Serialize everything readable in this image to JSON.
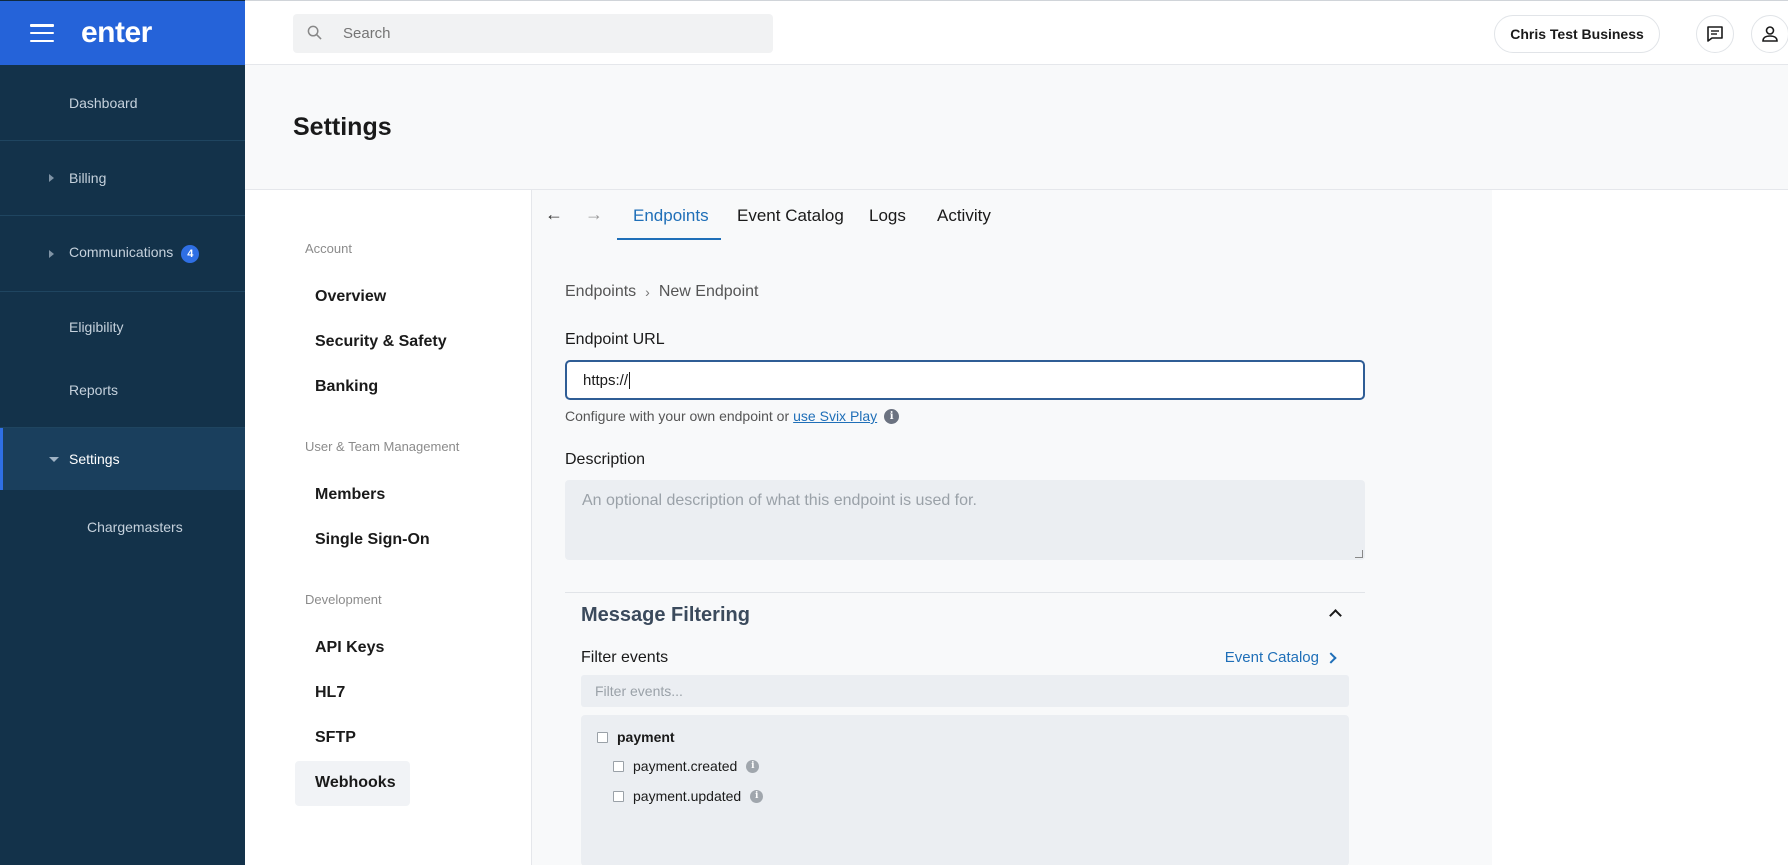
{
  "app": {
    "brand": "enter"
  },
  "sidebar": {
    "items": [
      {
        "label": "Dashboard"
      },
      {
        "label": "Billing"
      },
      {
        "label": "Communications",
        "badge": "4"
      },
      {
        "label": "Eligibility"
      },
      {
        "label": "Reports"
      },
      {
        "label": "Settings"
      },
      {
        "label": "Chargemasters"
      }
    ]
  },
  "topbar": {
    "search_placeholder": "Search",
    "business_label": "Chris Test Business"
  },
  "page": {
    "title": "Settings"
  },
  "settings_nav": {
    "sections": [
      {
        "title": "Account",
        "items": [
          "Overview",
          "Security & Safety",
          "Banking"
        ]
      },
      {
        "title": "User & Team Management",
        "items": [
          "Members",
          "Single Sign-On"
        ]
      },
      {
        "title": "Development",
        "items": [
          "API Keys",
          "HL7",
          "SFTP",
          "Webhooks"
        ]
      }
    ],
    "active": "Webhooks"
  },
  "tabs": {
    "back_arrow": "←",
    "forward_arrow": "→",
    "items": [
      "Endpoints",
      "Event Catalog",
      "Logs",
      "Activity"
    ],
    "active": "Endpoints"
  },
  "breadcrumb": {
    "parent": "Endpoints",
    "separator": "›",
    "current": "New Endpoint"
  },
  "form": {
    "endpoint_url_label": "Endpoint URL",
    "endpoint_url_value": "https://",
    "help_text": "Configure with your own endpoint or",
    "help_link": "use Svix Play",
    "description_label": "Description",
    "description_placeholder": "An optional description of what this endpoint is used for."
  },
  "message_filtering": {
    "title": "Message Filtering",
    "filter_events_label": "Filter events",
    "event_catalog_link": "Event Catalog",
    "filter_placeholder": "Filter events...",
    "events": [
      {
        "label": "payment",
        "children": [
          "payment.created",
          "payment.updated"
        ]
      }
    ]
  },
  "colors": {
    "brand": "#2563d9",
    "sidebar": "#13324a",
    "link": "#1f6fb8"
  }
}
